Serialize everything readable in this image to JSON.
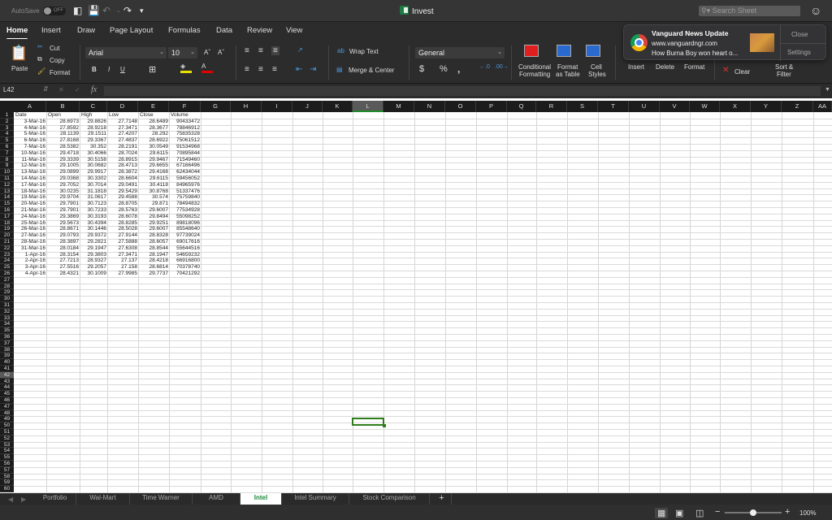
{
  "titlebar": {
    "autosave_label": "AutoSave",
    "autosave_state": "OFF",
    "title": "Invest",
    "search_placeholder": "Search Sheet"
  },
  "menu_tabs": [
    "Home",
    "Insert",
    "Draw",
    "Page Layout",
    "Formulas",
    "Data",
    "Review",
    "View"
  ],
  "active_tab": "Home",
  "ribbon": {
    "paste": "Paste",
    "cut": "Cut",
    "copy": "Copy",
    "format_painter": "Format",
    "font_name": "Arial",
    "font_size": "10",
    "bold": "B",
    "italic": "I",
    "underline": "U",
    "wrap_text": "Wrap Text",
    "merge_center": "Merge & Center",
    "number_format": "General",
    "currency": "$",
    "percent": "%",
    "comma": ",",
    "conditional_formatting": [
      "Conditional",
      "Formatting"
    ],
    "format_as_table": [
      "Format",
      "as Table"
    ],
    "cell_styles": [
      "Cell",
      "Styles"
    ],
    "insert": "Insert",
    "delete": "Delete",
    "format": "Format",
    "clear": "Clear",
    "sort_filter": [
      "Sort &",
      "Filter"
    ],
    "colors": {
      "highlight": "#e8e000",
      "font_color": "#e00000"
    }
  },
  "formula_bar": {
    "name_box": "L42",
    "fx": "fx",
    "value": ""
  },
  "notification": {
    "title": "Vanguard News Update",
    "source": "www.vanguardngr.com",
    "body": "How Burna Boy won heart o...",
    "close": "Close",
    "settings": "Settings"
  },
  "columns": [
    "A",
    "B",
    "C",
    "D",
    "E",
    "F",
    "G",
    "H",
    "I",
    "J",
    "K",
    "L",
    "M",
    "N",
    "O",
    "P",
    "Q",
    "R",
    "S",
    "T",
    "U",
    "V",
    "W",
    "X",
    "Y",
    "Z",
    "AA"
  ],
  "selected_cell": "L42",
  "table": {
    "headers": [
      "Date",
      "Open",
      "High",
      "Low",
      "Close",
      "Volume"
    ],
    "rows": [
      [
        "3-Mar-16",
        "28.6973",
        "29.8826",
        "27.7148",
        "28.6489",
        "90433472"
      ],
      [
        "4-Mar-16",
        "27.8592",
        "28.9218",
        "27.3471",
        "28.3677",
        "78846912"
      ],
      [
        "5-Mar-16",
        "28.1139",
        "29.1511",
        "27.4207",
        "28.292",
        "75835328"
      ],
      [
        "6-Mar-16",
        "27.8168",
        "29.3367",
        "27.4837",
        "28.6922",
        "75061512"
      ],
      [
        "7-Mar-16",
        "28.5382",
        "30.352",
        "28.2191",
        "30.0549",
        "91534968"
      ],
      [
        "10-Mar-16",
        "29.4718",
        "30.4066",
        "28.7024",
        "29.6115",
        "70895844"
      ],
      [
        "11-Mar-16",
        "29.3339",
        "30.5158",
        "28.8915",
        "29.9467",
        "71549460"
      ],
      [
        "12-Mar-16",
        "29.1005",
        "30.0682",
        "28.4713",
        "29.6655",
        "67166496"
      ],
      [
        "13-Mar-16",
        "29.0899",
        "29.9917",
        "28.3872",
        "29.4168",
        "62434044"
      ],
      [
        "14-Mar-16",
        "29.0368",
        "30.3302",
        "28.6604",
        "29.6115",
        "59456052"
      ],
      [
        "17-Mar-16",
        "29.7052",
        "30.7014",
        "29.0491",
        "30.4118",
        "84965976"
      ],
      [
        "18-Mar-16",
        "30.0235",
        "31.1818",
        "29.5429",
        "30.8768",
        "51337476"
      ],
      [
        "19-Mar-16",
        "29.9704",
        "31.0617",
        "29.4588",
        "30.574",
        "75759840"
      ],
      [
        "20-Mar-16",
        "29.7901",
        "30.7123",
        "28.8705",
        "29.871",
        "78494832"
      ],
      [
        "21-Mar-16",
        "29.7901",
        "30.7233",
        "28.5763",
        "29.6007",
        "77534928"
      ],
      [
        "24-Mar-16",
        "29.3869",
        "30.3193",
        "28.6078",
        "29.8494",
        "55098252"
      ],
      [
        "25-Mar-16",
        "29.5673",
        "30.4394",
        "28.8285",
        "29.9251",
        "89818096"
      ],
      [
        "26-Mar-16",
        "28.8671",
        "30.1446",
        "28.5028",
        "29.6007",
        "85548640"
      ],
      [
        "27-Mar-16",
        "29.0793",
        "29.9372",
        "27.9144",
        "28.8328",
        "97739024"
      ],
      [
        "28-Mar-16",
        "28.3897",
        "29.2821",
        "27.5888",
        "28.6057",
        "69017616"
      ],
      [
        "31-Mar-16",
        "28.0184",
        "29.1947",
        "27.6308",
        "28.8544",
        "55644516"
      ],
      [
        "1-Apr-16",
        "28.3154",
        "29.3803",
        "27.3471",
        "28.1947",
        "54659232"
      ],
      [
        "2-Apr-16",
        "27.7213",
        "28.9327",
        "27.137",
        "28.4218",
        "66916800"
      ],
      [
        "3-Apr-16",
        "27.5516",
        "29.2057",
        "27.158",
        "28.6814",
        "70378740"
      ],
      [
        "4-Apr-16",
        "28.4321",
        "30.1009",
        "27.9985",
        "29.7737",
        "70421292"
      ]
    ]
  },
  "sheet_tabs": [
    "Portfolio",
    "Wal-Mart",
    "Time Warner",
    "AMD",
    "Intel",
    "Intel Summary",
    "Stock Comparison"
  ],
  "active_sheet": "Intel",
  "add_sheet": "+",
  "status": {
    "zoom": "100%",
    "zoom_fraction": 0.5
  }
}
